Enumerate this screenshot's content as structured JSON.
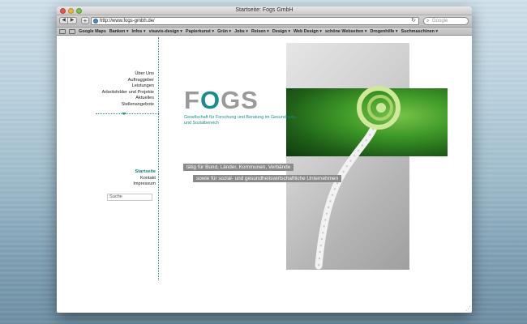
{
  "window": {
    "title": "Startseite: Fogs GmbH",
    "url": "http://www.fogs-gmbh.de/",
    "search_placeholder": "Google"
  },
  "toolbar": {
    "back_label": "◀",
    "forward_label": "▶",
    "add_label": "+",
    "reload_label": "↻"
  },
  "bookmarks": [
    "Google Maps",
    "Banken ▾",
    "Infos ▾",
    "visavis-design ▾",
    "Papierkunst ▾",
    "Grün ▾",
    "Jobs ▾",
    "Reisen ▾",
    "Design ▾",
    "Web Design ▾",
    "schöne Webseiten ▾",
    "Drogenhilfe ▾",
    "Suchmaschinen ▾"
  ],
  "nav_top": [
    "Über Uns",
    "Auftraggeber",
    "Leistungen",
    "Arbeitsfelder und Projekte",
    "Aktuelles",
    "Stellenangebote"
  ],
  "nav_bottom": [
    "Startseite",
    "Kontakt",
    "Impressum"
  ],
  "search": {
    "label": "Suche"
  },
  "logo": {
    "letter_f": "F",
    "letter_o": "O",
    "letters_gs": "GS",
    "tagline": "Gesellschaft für Forschung und Beratung im Gesundheits- und Sozialbereich"
  },
  "banners": {
    "line1": "tätig für Bund, Länder, Kommunen, Verbände",
    "line2": "sowie für sozial- und gesundheitswirtschaftliche Unternehmen"
  },
  "colors": {
    "accent": "#1b8c8c",
    "logo_gray": "#9a9a9a",
    "banner_bg": "#8a8a8a"
  }
}
